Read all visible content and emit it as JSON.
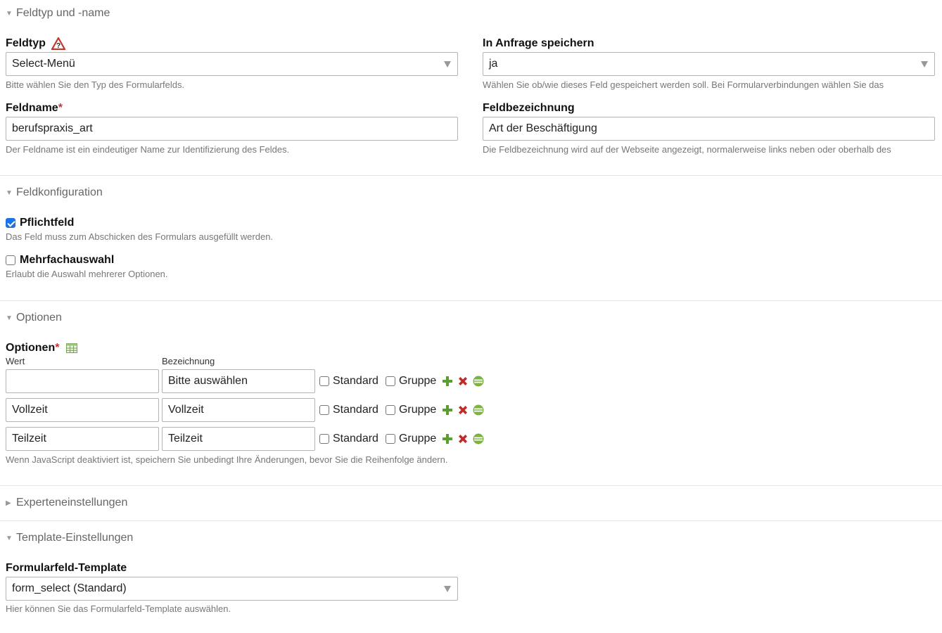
{
  "sections": {
    "feldtyp": {
      "legend": "Feldtyp und -name"
    },
    "feldkonfig": {
      "legend": "Feldkonfiguration"
    },
    "optionen": {
      "legend": "Optionen"
    },
    "experten": {
      "legend": "Experteneinstellungen"
    },
    "template": {
      "legend": "Template-Einstellungen"
    }
  },
  "feldtyp": {
    "label": "Feldtyp",
    "value": "Select-Menü",
    "help": "Bitte wählen Sie den Typ des Formularfelds."
  },
  "speichern": {
    "label": "In Anfrage speichern",
    "value": "ja",
    "help": "Wählen Sie ob/wie dieses Feld gespeichert werden soll. Bei Formularverbindungen wählen Sie das"
  },
  "feldname": {
    "label": "Feldname",
    "required": "*",
    "value": "berufspraxis_art",
    "help": "Der Feldname ist ein eindeutiger Name zur Identifizierung des Feldes."
  },
  "feldbezeichnung": {
    "label": "Feldbezeichnung",
    "value": "Art der Beschäftigung",
    "help": "Die Feldbezeichnung wird auf der Webseite angezeigt, normalerweise links neben oder oberhalb des"
  },
  "pflicht": {
    "label": "Pflichtfeld",
    "checked": true,
    "help": "Das Feld muss zum Abschicken des Formulars ausgefüllt werden."
  },
  "mehrfach": {
    "label": "Mehrfachauswahl",
    "checked": false,
    "help": "Erlaubt die Auswahl mehrerer Optionen."
  },
  "options": {
    "label": "Optionen",
    "required": "*",
    "col_wert": "Wert",
    "col_bezeichnung": "Bezeichnung",
    "standard_label": "Standard",
    "gruppe_label": "Gruppe",
    "rows": [
      {
        "wert": "",
        "bezeichnung": "Bitte auswählen"
      },
      {
        "wert": "Vollzeit",
        "bezeichnung": "Vollzeit"
      },
      {
        "wert": "Teilzeit",
        "bezeichnung": "Teilzeit"
      }
    ],
    "help": "Wenn JavaScript deaktiviert ist, speichern Sie unbedingt Ihre Änderungen, bevor Sie die Reihenfolge ändern."
  },
  "template_field": {
    "label": "Formularfeld-Template",
    "value": "form_select (Standard)",
    "help": "Hier können Sie das Formularfeld-Template auswählen."
  },
  "colors": {
    "required": "#cc3333",
    "add": "#5a9e2f",
    "delete": "#c62828",
    "move": "#7cb342",
    "checkbox": "#1a73e8"
  }
}
